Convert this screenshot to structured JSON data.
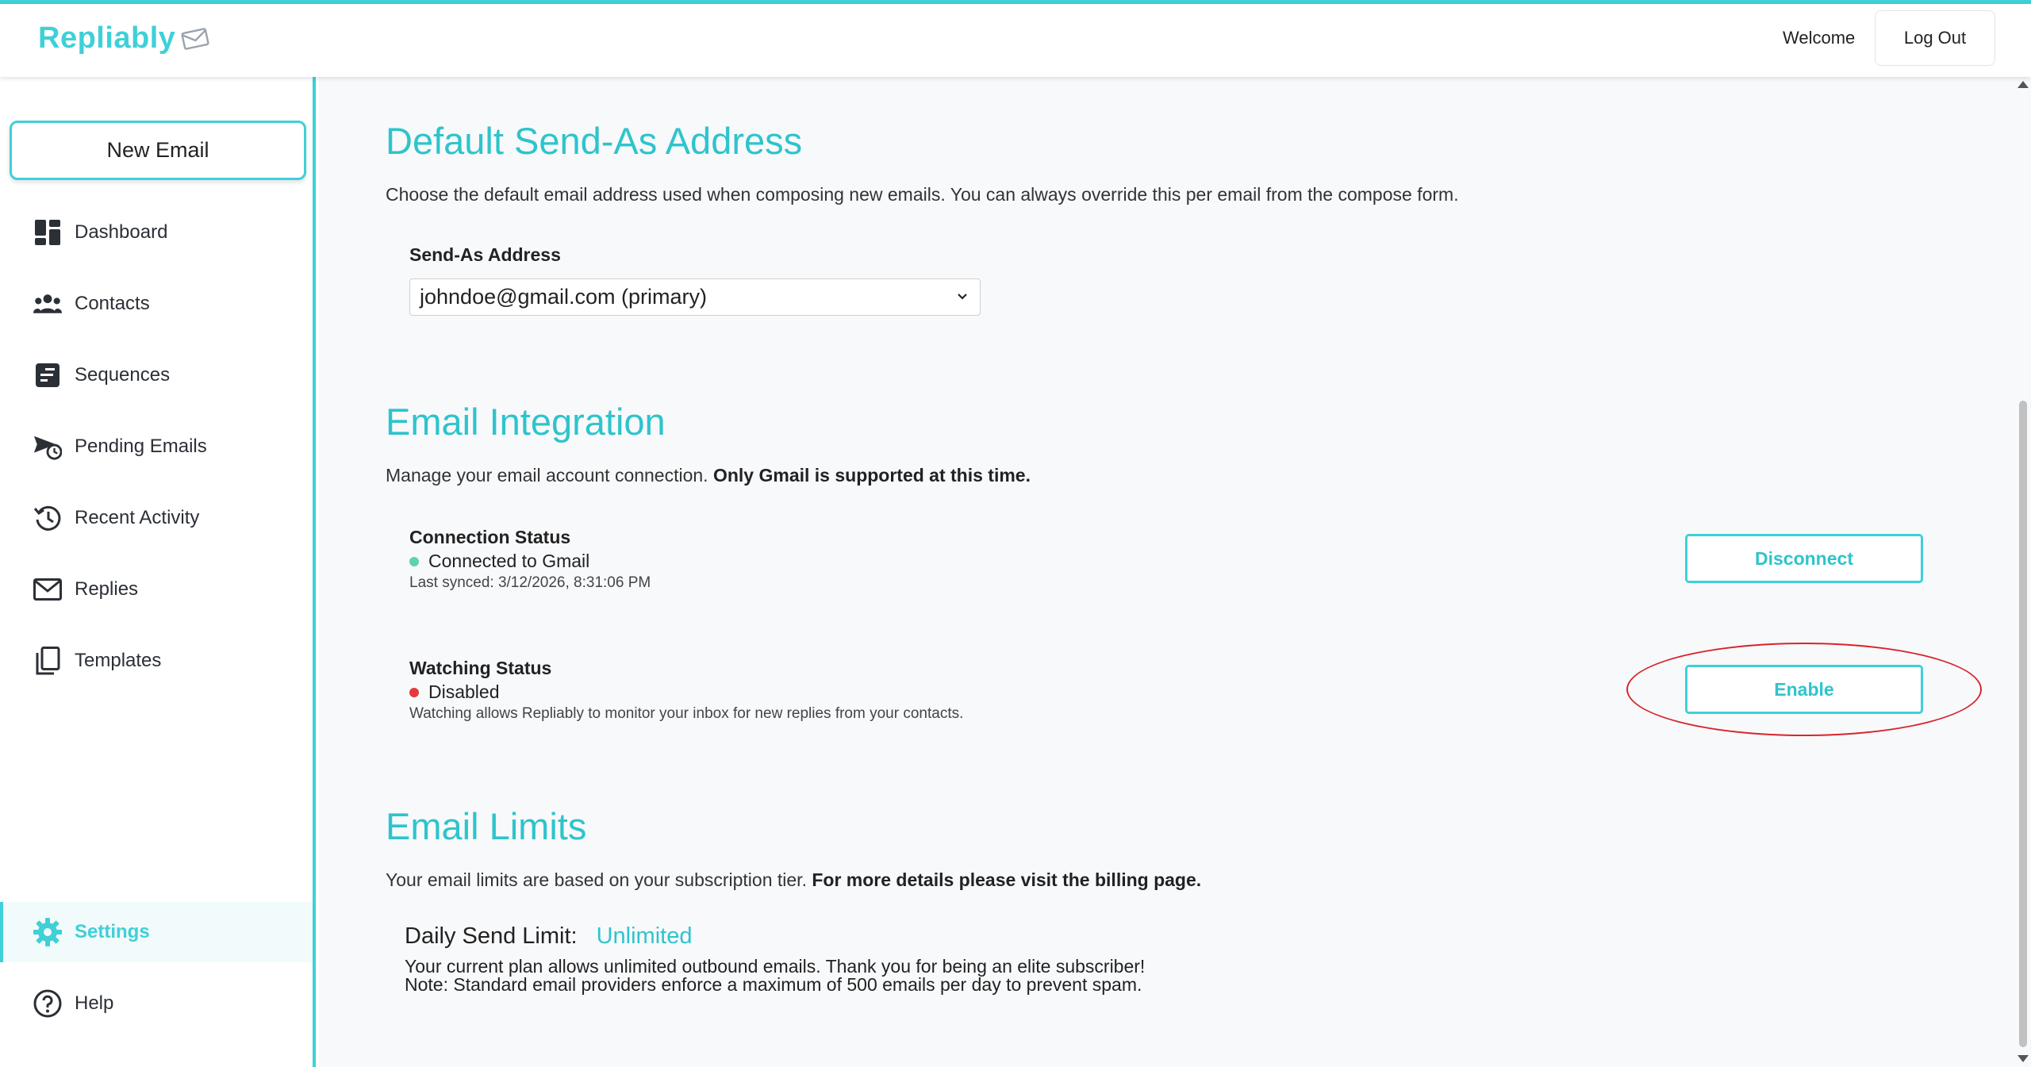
{
  "app": {
    "name": "Repliably"
  },
  "header": {
    "welcome": "Welcome",
    "logout_label": "Log Out"
  },
  "sidebar": {
    "new_email_label": "New Email",
    "items": [
      {
        "label": "Dashboard",
        "icon": "dashboard-icon"
      },
      {
        "label": "Contacts",
        "icon": "contacts-icon"
      },
      {
        "label": "Sequences",
        "icon": "sequences-icon"
      },
      {
        "label": "Pending Emails",
        "icon": "pending-emails-icon"
      },
      {
        "label": "Recent Activity",
        "icon": "history-icon"
      },
      {
        "label": "Replies",
        "icon": "envelope-icon"
      },
      {
        "label": "Templates",
        "icon": "templates-icon"
      }
    ],
    "bottom_items": [
      {
        "label": "Settings",
        "icon": "gear-icon",
        "active": true
      },
      {
        "label": "Help",
        "icon": "help-icon"
      }
    ]
  },
  "send_as": {
    "title": "Default Send-As Address",
    "description": "Choose the default email address used when composing new emails. You can always override this per email from the compose form.",
    "field_label": "Send-As Address",
    "selected": "johndoe@gmail.com (primary)"
  },
  "integration": {
    "title": "Email Integration",
    "description": "Manage your email account connection.",
    "description_bold": "Only Gmail is supported at this time.",
    "connection": {
      "title": "Connection Status",
      "status": "Connected to Gmail",
      "sub": "Last synced: 3/12/2026, 8:31:06 PM",
      "button": "Disconnect",
      "dot_color": "#5fd3a8"
    },
    "watching": {
      "title": "Watching Status",
      "status": "Disabled",
      "sub": "Watching allows Repliably to monitor your inbox for new replies from your contacts.",
      "button": "Enable",
      "dot_color": "#e5393b"
    }
  },
  "limits": {
    "title": "Email Limits",
    "description": "Your email limits are based on your subscription tier.",
    "description_bold": "For more details please visit the billing page.",
    "daily_label": "Daily Send Limit:",
    "daily_value": "Unlimited",
    "line1": "Your current plan allows unlimited outbound emails. Thank you for being an elite subscriber!",
    "line2": "Note: Standard email providers enforce a maximum of 500 emails per day to prevent spam."
  },
  "colors": {
    "accent": "#3fd0d8",
    "heading": "#2ec4cc",
    "highlight": "#d9242b"
  }
}
